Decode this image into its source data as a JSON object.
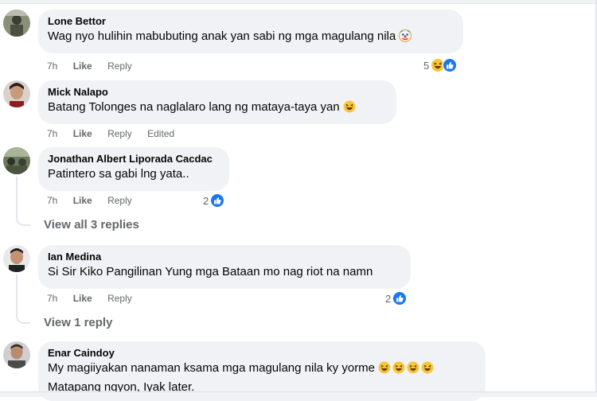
{
  "comments": [
    {
      "author": "Lone Bettor",
      "text": "Wag nyo hulihin mabubuting anak yan sabi ng mga magulang nila",
      "time": "7h",
      "like": "Like",
      "reply": "Reply",
      "reaction_count": "5",
      "reactions": [
        "haha-icon",
        "like-icon"
      ]
    },
    {
      "author": "Mick Nalapo",
      "text": "Batang Tolonges na naglalaro lang ng mataya-taya yan",
      "time": "7h",
      "like": "Like",
      "reply": "Reply",
      "edited": "Edited"
    },
    {
      "author": "Jonathan Albert Liporada Cacdac",
      "text": "Patintero sa gabi lng yata..",
      "time": "7h",
      "like": "Like",
      "reply": "Reply",
      "reaction_count": "2",
      "reactions": [
        "like-icon"
      ],
      "view_replies": "View all 3 replies"
    },
    {
      "author": "Ian Medina",
      "text": "Si Sir Kiko Pangilinan Yung mga Bataan mo nag riot na namn",
      "time": "7h",
      "like": "Like",
      "reply": "Reply",
      "reaction_count": "2",
      "reactions": [
        "like-icon"
      ],
      "view_replies": "View 1 reply"
    },
    {
      "author": "Enar Caindoy",
      "text": "My magiiyakan nanaman ksama mga magulang nila ky yorme",
      "text2": "Matapang ngyon, Iyak later."
    }
  ],
  "colors": {
    "bubble": "#f0f2f5",
    "meta_text": "#65676b",
    "like_blue": "#1877f2",
    "haha_yellow": "#f7c737"
  }
}
